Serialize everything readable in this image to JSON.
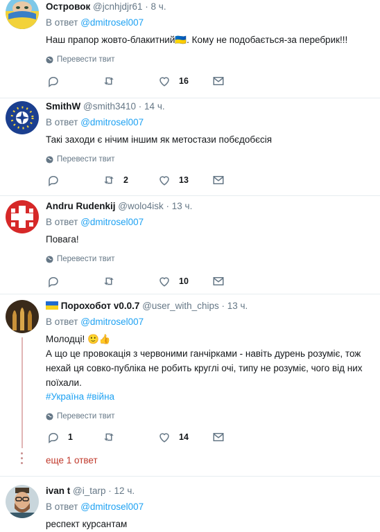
{
  "common": {
    "reply_prefix": "В ответ",
    "reply_mention": "@dmitrosel007",
    "translate_label": "Перевести твит",
    "dot": "·"
  },
  "colors": {
    "accent": "#1da1f2",
    "muted": "#657786",
    "thread": "#e1b4b4",
    "more_link": "#c0392b"
  },
  "tweets": [
    {
      "name": "Островок",
      "handle": "@jcnhjdjr61",
      "time": "8 ч.",
      "text": "Наш прапор жовто-блакитний🇺🇦. Кому не подобається-за перебрик!!!",
      "replies": "",
      "retweets": "",
      "likes": "16",
      "avatar_icon": "woman-flag-scarf-avatar"
    },
    {
      "name": "SmithW",
      "handle": "@smith3410",
      "time": "14 ч.",
      "text": "Такі заходи є нічим іншим як метостази побєдобєсія",
      "replies": "",
      "retweets": "2",
      "likes": "13",
      "avatar_icon": "nato-eu-avatar"
    },
    {
      "name": "Andru Rudenkij",
      "handle": "@wolo4isk",
      "time": "13 ч.",
      "text": "Повага!",
      "replies": "",
      "retweets": "",
      "likes": "10",
      "avatar_icon": "white-cross-avatar"
    },
    {
      "name": "Порохобот v0.0.7",
      "handle": "@user_with_chips",
      "time": "13 ч.",
      "text_line1": "Молодці! 🙂👍",
      "text_line2": "А що це провокація з червоними ганчірками - навіть дурень розуміє, тож нехай ця совко-публіка не робить круглі очі, типу не розуміє, чого від них поїхали.",
      "hashtags": "#Україна #війна",
      "replies": "1",
      "retweets": "",
      "likes": "14",
      "more_replies": "еще 1 ответ",
      "avatar_icon": "bullets-avatar"
    },
    {
      "name": "ivan t",
      "handle": "@i_tarp",
      "time": "12 ч.",
      "text": "респект курсантам",
      "avatar_icon": "bearded-man-avatar"
    }
  ]
}
